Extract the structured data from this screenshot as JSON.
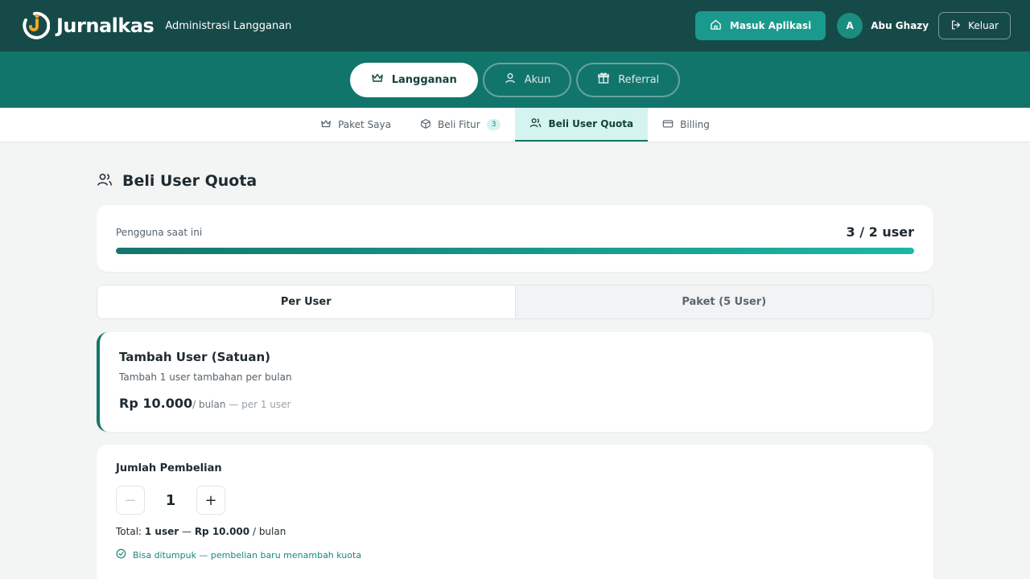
{
  "header": {
    "brand": "Jurnalkas",
    "subtitle": "Administrasi Langganan",
    "open_app_label": "Masuk Aplikasi",
    "user_initial": "A",
    "user_name": "Abu Ghazy",
    "logout_label": "Keluar"
  },
  "main_nav": [
    {
      "label": "Langganan",
      "icon": "crown-icon",
      "active": true
    },
    {
      "label": "Akun",
      "icon": "user-icon",
      "active": false
    },
    {
      "label": "Referral",
      "icon": "gift-icon",
      "active": false
    }
  ],
  "sub_tabs": [
    {
      "label": "Paket Saya",
      "icon": "crown-icon",
      "active": false
    },
    {
      "label": "Beli Fitur",
      "icon": "box-icon",
      "badge": "3",
      "active": false
    },
    {
      "label": "Beli User Quota",
      "icon": "users-icon",
      "active": true
    },
    {
      "label": "Billing",
      "icon": "card-icon",
      "active": false
    }
  ],
  "page": {
    "title": "Beli User Quota",
    "usage": {
      "label": "Pengguna saat ini",
      "value": "3 / 2 user",
      "progress_fraction": 1.0
    },
    "segment": {
      "options": [
        "Per User",
        "Paket (5 User)"
      ],
      "selected": "Per User"
    },
    "plan": {
      "title": "Tambah User (Satuan)",
      "description": "Tambah 1 user tambahan per bulan",
      "price": "Rp 10.000",
      "unit": "/ bulan",
      "per_note": " — per 1 user"
    },
    "quantity": {
      "title": "Jumlah Pembelian",
      "decrement": "−",
      "value": "1",
      "increment": "+",
      "total_prefix": "Total: ",
      "total_users": "1 user",
      "total_sep": " — ",
      "total_price": "Rp 10.000",
      "total_unit": " / bulan",
      "note": "Bisa ditumpuk — pembelian baru menambah kuota"
    }
  },
  "colors": {
    "header_bg": "#164a48",
    "nav_bg": "#12756c",
    "accent": "#1a9a8c",
    "active_tab_bg": "#d6f4ef"
  }
}
